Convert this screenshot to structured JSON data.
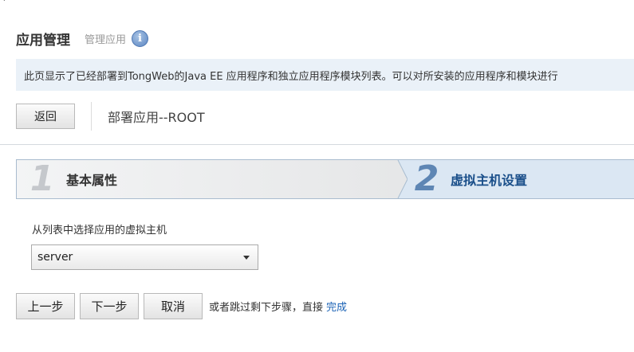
{
  "corner_mark": "`",
  "header": {
    "title": "应用管理",
    "subtitle": "管理应用",
    "info_icon_glyph": "i"
  },
  "description": "此页显示了已经部署到TongWeb的Java EE 应用程序和独立应用程序模块列表。可以对所安装的应用程序和模块进行",
  "toolbar": {
    "back_label": "返回",
    "deploy_title": "部署应用--ROOT"
  },
  "steps": [
    {
      "number": "1",
      "label": "基本属性",
      "active": false
    },
    {
      "number": "2",
      "label": "虚拟主机设置",
      "active": true
    }
  ],
  "virtual_host": {
    "label": "从列表中选择应用的虚拟主机",
    "selected": "server"
  },
  "actions": {
    "prev_label": "上一步",
    "next_label": "下一步",
    "cancel_label": "取消",
    "skip_text": "或者跳过剩下步骤，直接",
    "finish_label": "完成"
  },
  "colors": {
    "description_bg": "#eaf1f8",
    "active_step_bg": "#dbe7f3",
    "active_step_text": "#1a4f8a",
    "link": "#1a62b5"
  }
}
